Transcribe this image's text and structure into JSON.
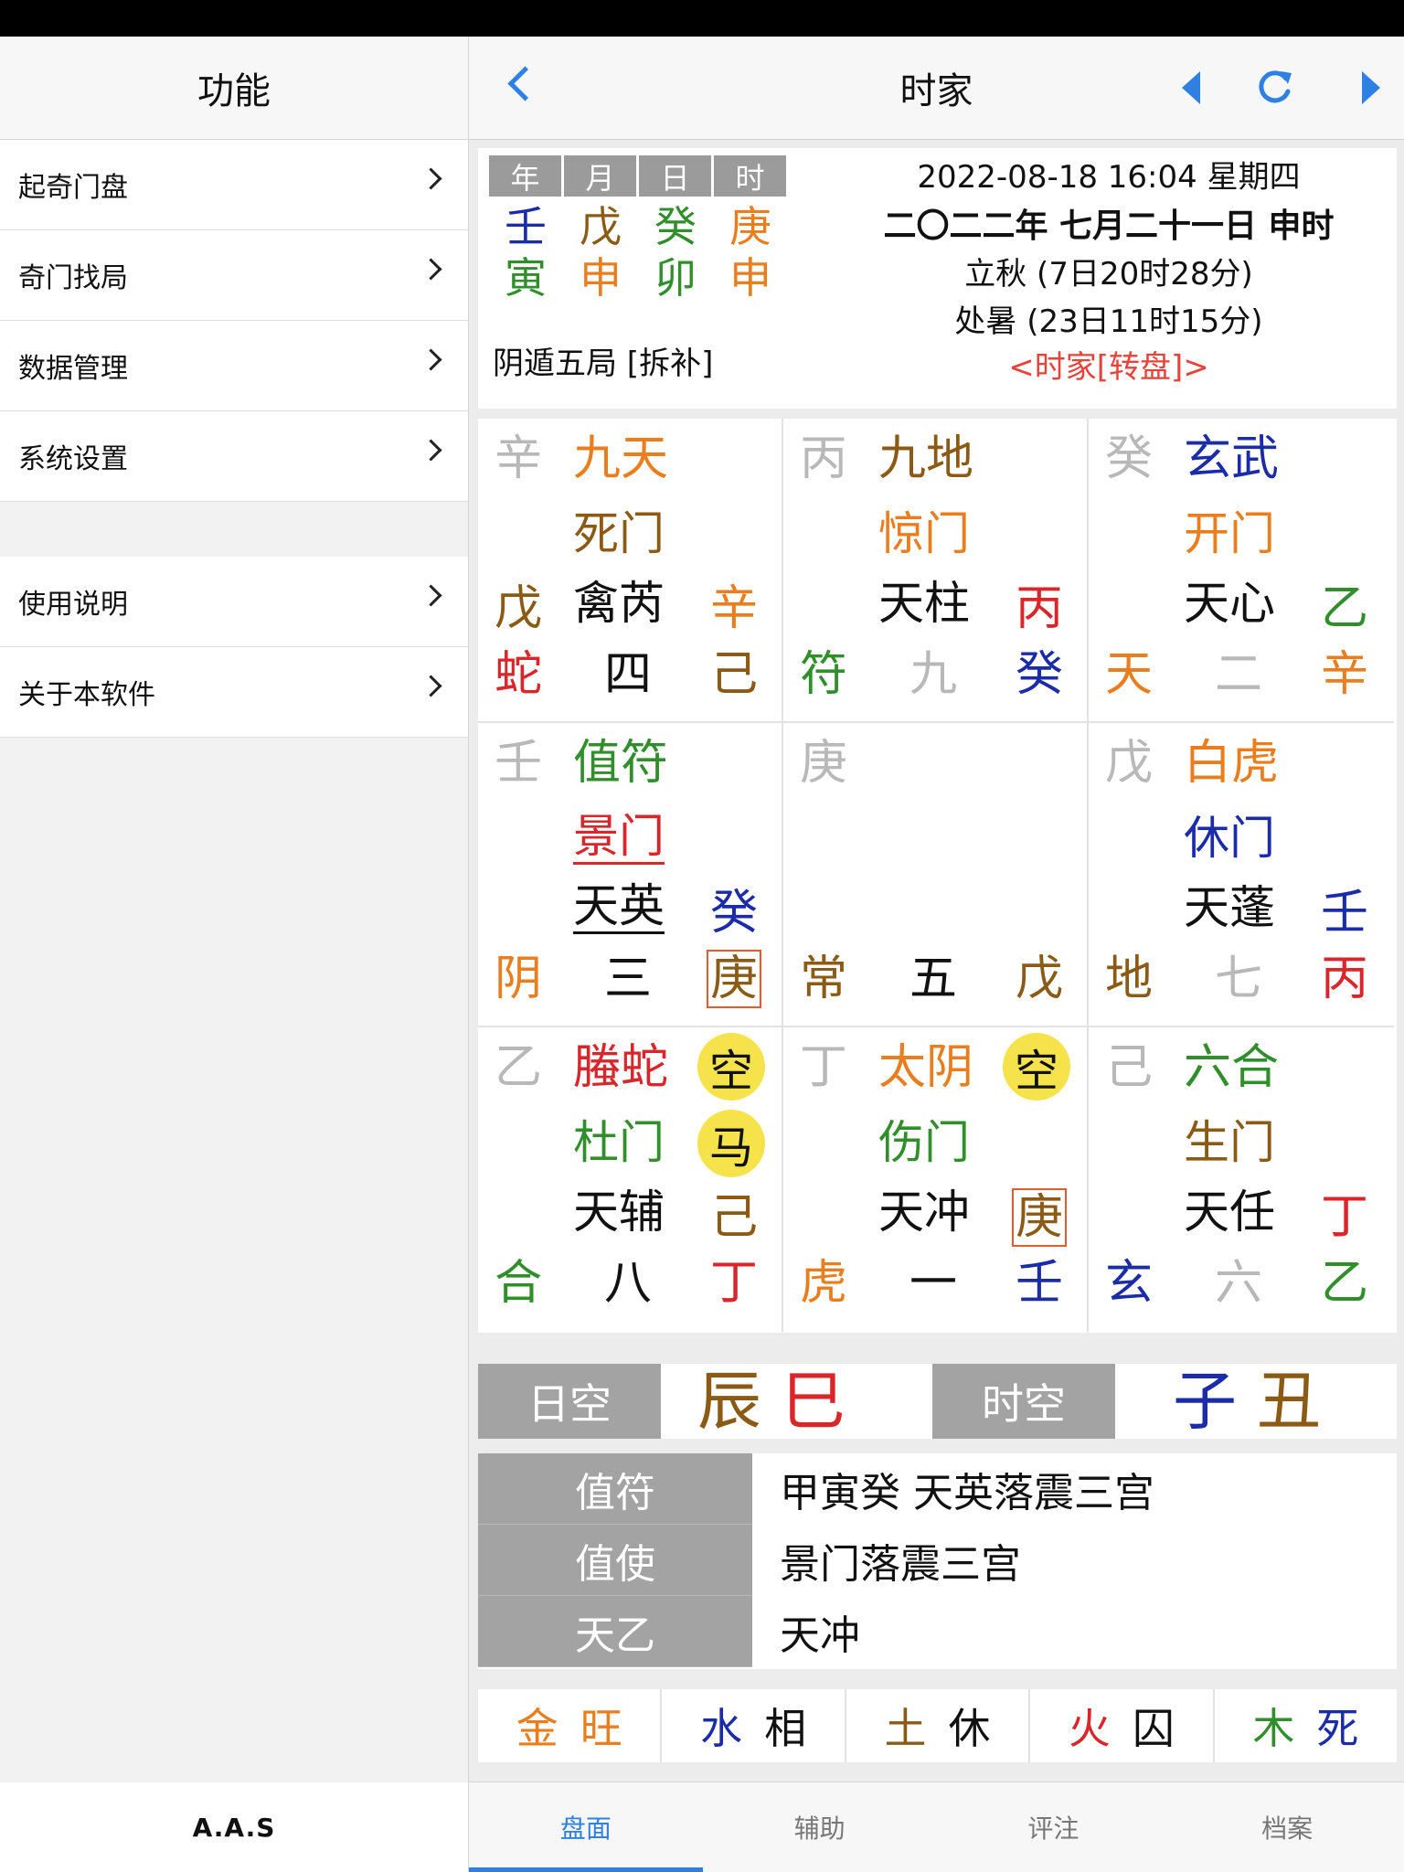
{
  "colors": {
    "accent": "#2f80e4",
    "red": "#d8262a",
    "orange": "#ea7d1e",
    "brown": "#8b5a14",
    "green": "#318f2b",
    "blue": "#1b2ca8",
    "gray": "#b8b8b8"
  },
  "sidebar": {
    "title": "功能",
    "items": [
      "起奇门盘",
      "奇门找局",
      "数据管理",
      "系统设置"
    ],
    "items2": [
      "使用说明",
      "关于本软件"
    ],
    "footer": "A.A.S"
  },
  "nav": {
    "title": "时家",
    "icons": [
      "back-icon",
      "prev-icon",
      "refresh-icon",
      "next-icon"
    ]
  },
  "info": {
    "pillars_header": [
      "年",
      "月",
      "日",
      "时"
    ],
    "stems": [
      "壬",
      "戊",
      "癸",
      "庚"
    ],
    "branches": [
      "寅",
      "申",
      "卯",
      "申"
    ],
    "ju": "阴遁五局 [拆补]",
    "date": "2022-08-18 16:04 星期四",
    "lunar": "二〇二二年 七月二十一日 申时",
    "term1": "立秋 (7日20时28分)",
    "term2": "处暑 (23日11时15分)",
    "mode": "<时家[转盘]>"
  },
  "palaces": [
    {
      "earth_tl": "辛",
      "god": "九天",
      "door": "死门",
      "left_stem": "戊",
      "star": "禽芮",
      "right_stem": "辛",
      "spirit": "蛇",
      "number": "四",
      "earth_br": "己"
    },
    {
      "earth_tl": "丙",
      "god": "九地",
      "door": "惊门",
      "left_stem": "",
      "star": "天柱",
      "right_stem": "丙",
      "spirit": "符",
      "number": "九",
      "earth_br": "癸"
    },
    {
      "earth_tl": "癸",
      "god": "玄武",
      "door": "开门",
      "left_stem": "",
      "star": "天心",
      "right_stem": "乙",
      "spirit": "天",
      "number": "二",
      "earth_br": "辛"
    },
    {
      "earth_tl": "壬",
      "god": "值符",
      "door": "景门",
      "left_stem": "",
      "star": "天英",
      "right_stem": "癸",
      "spirit": "阴",
      "number": "三",
      "earth_br": "庚"
    },
    {
      "earth_tl": "庚",
      "god": "",
      "door": "",
      "left_stem": "",
      "star": "",
      "right_stem": "",
      "spirit": "常",
      "number": "五",
      "earth_br": "戊"
    },
    {
      "earth_tl": "戊",
      "god": "白虎",
      "door": "休门",
      "left_stem": "",
      "star": "天蓬",
      "right_stem": "壬",
      "spirit": "地",
      "number": "七",
      "earth_br": "丙"
    },
    {
      "earth_tl": "乙",
      "god": "螣蛇",
      "door": "杜门",
      "left_stem": "",
      "star": "天辅",
      "right_stem": "己",
      "spirit": "合",
      "number": "八",
      "earth_br": "丁",
      "badge1": "空",
      "badge2": "马"
    },
    {
      "earth_tl": "丁",
      "god": "太阴",
      "door": "伤门",
      "left_stem": "",
      "star": "天冲",
      "right_stem": "庚",
      "spirit": "虎",
      "number": "一",
      "earth_br": "壬",
      "badge1": "空"
    },
    {
      "earth_tl": "己",
      "god": "六合",
      "door": "生门",
      "left_stem": "",
      "star": "天任",
      "right_stem": "丁",
      "spirit": "玄",
      "number": "六",
      "earth_br": "乙"
    }
  ],
  "kong": {
    "day_label": "日空",
    "day_values": [
      "辰",
      "巳"
    ],
    "hour_label": "时空",
    "hour_values": [
      "子",
      "丑"
    ]
  },
  "zhi": [
    {
      "label": "值符",
      "value": "甲寅癸  天英落震三宫"
    },
    {
      "label": "值使",
      "value": "景门落震三宫"
    },
    {
      "label": "天乙",
      "value": "天冲"
    }
  ],
  "seasons": [
    {
      "element": "金",
      "state": "旺"
    },
    {
      "element": "水",
      "state": "相"
    },
    {
      "element": "土",
      "state": "休"
    },
    {
      "element": "火",
      "state": "囚"
    },
    {
      "element": "木",
      "state": "死"
    }
  ],
  "tabs": [
    "盘面",
    "辅助",
    "评注",
    "档案"
  ]
}
